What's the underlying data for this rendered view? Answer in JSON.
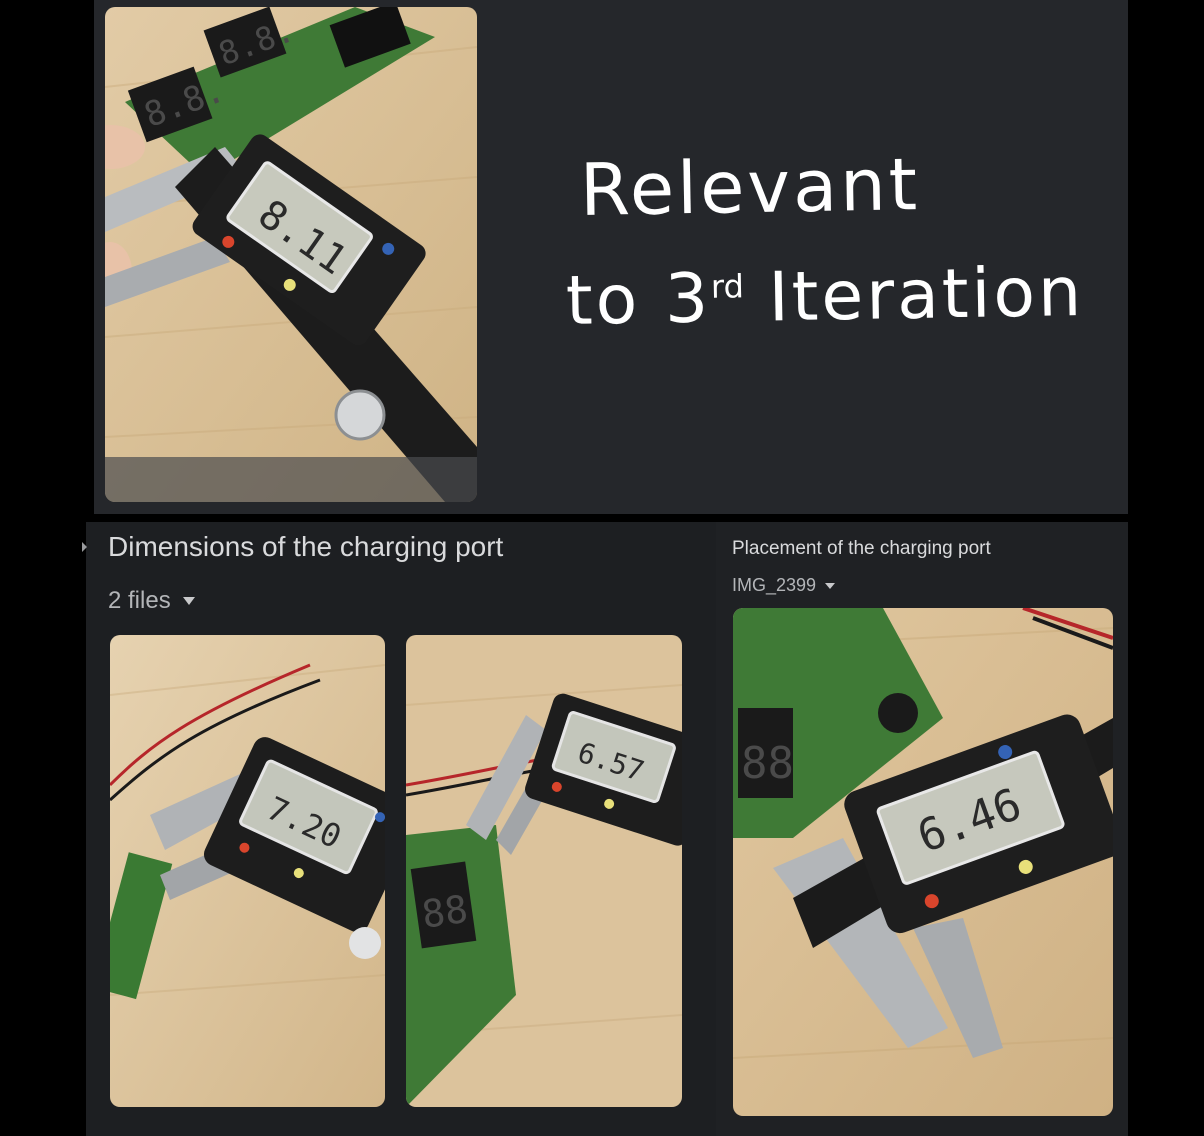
{
  "overlay_note": {
    "line1": "Relevant",
    "line2_prefix": "to 3",
    "line2_sup": "rd",
    "line2_suffix": " Iteration"
  },
  "dimensions_section": {
    "title": "Dimensions of the charging port",
    "files_label": "2 files"
  },
  "placement_section": {
    "title": "Placement of the charging port",
    "file_label": "IMG_2399"
  },
  "photos": {
    "top_reading": "8.11",
    "left_reading": "7.20",
    "middle_reading": "6.57",
    "right_reading": "6.46"
  },
  "colors": {
    "panel_dark": "#25272b",
    "panel_darker": "#1d1f22",
    "wood": "#dcc39c",
    "pcb_green": "#3f7a36",
    "caliper_black": "#1e1e1e",
    "lcd": "#c7c9bd"
  }
}
